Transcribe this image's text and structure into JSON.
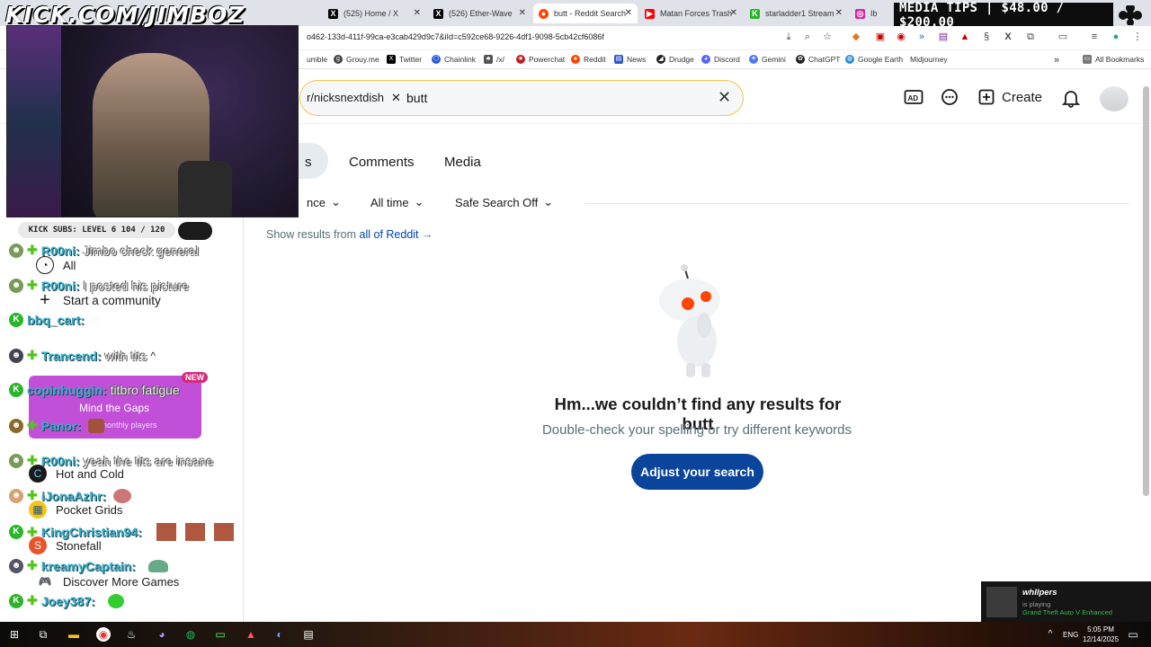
{
  "browser": {
    "tabs": [
      {
        "label": "(525) Home / X",
        "icon": "x-logo"
      },
      {
        "label": "(526) Ether-Wave",
        "icon": "x-logo"
      },
      {
        "label": "butt - Reddit Search",
        "icon": "reddit-logo",
        "active": true
      },
      {
        "label": "Matan Forces Trash",
        "icon": "youtube-logo"
      },
      {
        "label": "starladder1 Stream",
        "icon": "kick-logo"
      },
      {
        "label": "Ib",
        "icon": "instagram-logo"
      }
    ],
    "url": "o462-133d-411f-99ca-e3cab429d9c7&iId=c592ce68-9226-4df1-9098-5cb42cf6086f",
    "bookmarks": [
      "umble",
      "Grouy.me",
      "Twitter",
      "Chainlink",
      "/x/",
      "Powerchat",
      "Reddit",
      "News",
      "Drudge",
      "Discord",
      "Gemini",
      "ChatGPT",
      "Google Earth",
      "Midjourney"
    ],
    "all_bookmarks": "All Bookmarks"
  },
  "overlay": {
    "media_tips": "MEDIA TIPS | $48.00 / $200.00",
    "watermark": "KICK.COM/JIMBOZ",
    "subs": "KICK SUBS: LEVEL 6 104 / 120"
  },
  "search": {
    "chip": "r/nicksnextdish",
    "query": "butt"
  },
  "header": {
    "create_label": "Create"
  },
  "result_tabs": [
    "s",
    "Comments",
    "Media"
  ],
  "filters": {
    "sort": "nce",
    "time": "All time",
    "safe": "Safe Search Off"
  },
  "show_results": {
    "prefix": "Show results from",
    "link": "all of Reddit"
  },
  "empty": {
    "title": "Hm...we couldn’t find any results for butt",
    "hint": "Double-check your spelling or try different keywords",
    "button": "Adjust your search"
  },
  "sidebar": {
    "items": [
      {
        "label": "All",
        "icon": "all-icon"
      },
      {
        "label": "Start a community",
        "icon": "plus-icon"
      },
      {
        "label": "Mind the Gaps",
        "icon": "game-icon"
      },
      {
        "label": "Hot and Cold",
        "icon": "game-icon"
      },
      {
        "label": "Pocket Grids",
        "icon": "game-icon"
      },
      {
        "label": "Stonefall",
        "icon": "game-icon"
      },
      {
        "label": "Discover More Games",
        "icon": "controller-icon"
      }
    ],
    "promo_sub": "9K monthly players",
    "promo_new": "NEW"
  },
  "chat": [
    {
      "user": "R00ni:",
      "msg": "Jimbo check general"
    },
    {
      "user": "R00ni:",
      "msg": "I posted his picture"
    },
    {
      "user": "bbq_cart:",
      "msg": ""
    },
    {
      "user": "Trancend:",
      "msg": "with tits"
    },
    {
      "user": "copinhuggin:",
      "msg": "titbro fatigue"
    },
    {
      "user": "Panor:",
      "msg": ""
    },
    {
      "user": "R00ni:",
      "msg": "yeah the tits are insane"
    },
    {
      "user": "iJonaAzhr:",
      "msg": ""
    },
    {
      "user": "KingChristian94:",
      "msg": ""
    },
    {
      "user": "kreamyCaptain:",
      "msg": ""
    },
    {
      "user": "Joey387:",
      "msg": ""
    }
  ],
  "notification": {
    "name": "whllpers",
    "status": "is playing",
    "game": "Grand Theft Auto V Enhanced"
  },
  "taskbar": {
    "time": "5:05 PM",
    "date": "12/14/2025",
    "lang": "ENG"
  },
  "colors": {
    "reddit_blue": "#0a449b",
    "chip_border": "#f2c94c",
    "promo": "#c14fd8",
    "kick_green": "#53c51a"
  }
}
